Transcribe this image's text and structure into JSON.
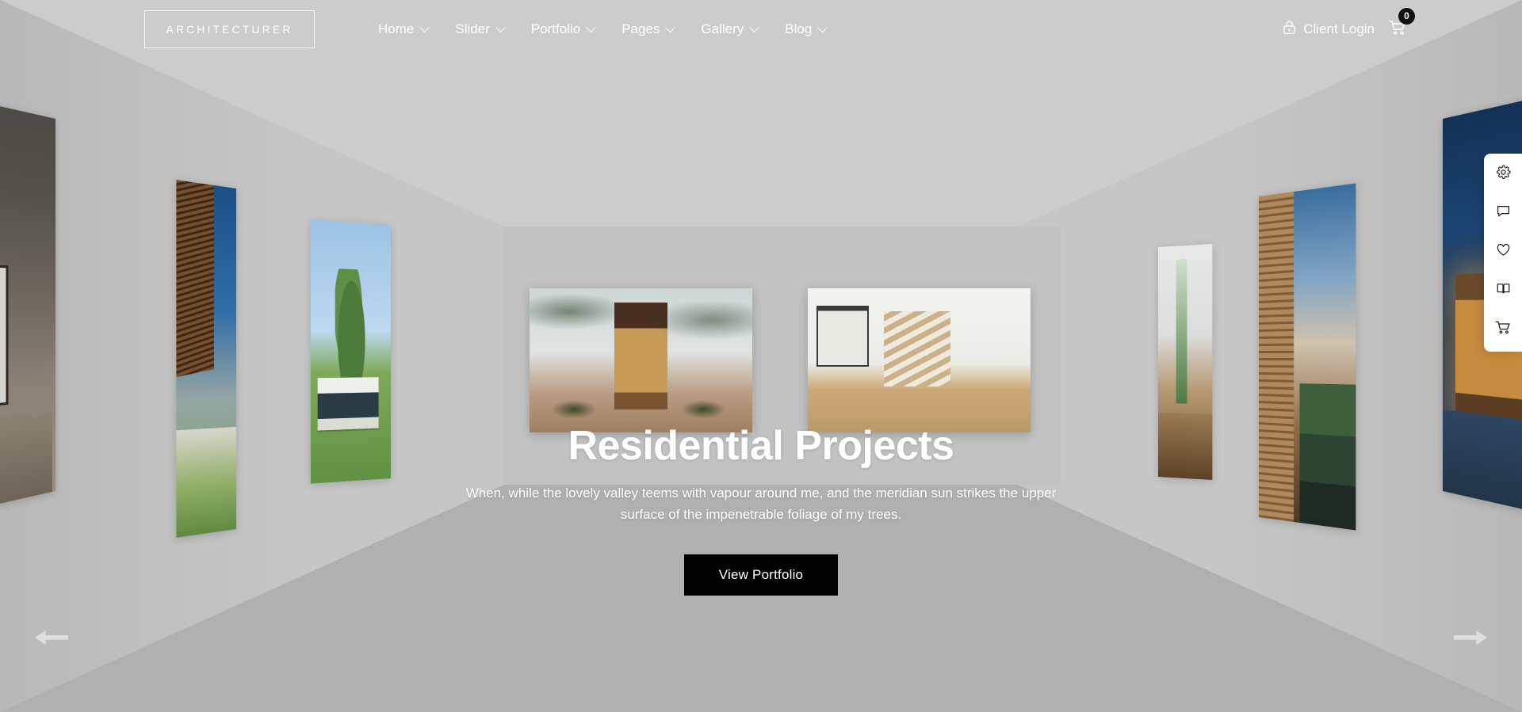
{
  "header": {
    "logo": {
      "text": "ARCHITECTURER",
      "name": "site-logo"
    },
    "nav": [
      {
        "label": "Home",
        "has_dropdown": true
      },
      {
        "label": "Slider",
        "has_dropdown": true
      },
      {
        "label": "Portfolio",
        "has_dropdown": true
      },
      {
        "label": "Pages",
        "has_dropdown": true
      },
      {
        "label": "Gallery",
        "has_dropdown": true
      },
      {
        "label": "Blog",
        "has_dropdown": true
      }
    ],
    "client_login": {
      "label": "Client Login",
      "icon": "lock-icon"
    },
    "cart": {
      "icon": "shopping-cart-icon",
      "count": "0"
    }
  },
  "hero": {
    "title": "Residential Projects",
    "description": "When, while the lovely valley teems with vapour around me, and the meridian sun strikes the upper surface of the impenetrable foliage of my trees.",
    "cta_label": "View Portfolio"
  },
  "side_toolbar": {
    "items": [
      {
        "icon": "gear-icon",
        "label": "Settings"
      },
      {
        "icon": "chat-bubble-icon",
        "label": "Comments"
      },
      {
        "icon": "heart-icon",
        "label": "Favorites"
      },
      {
        "icon": "book-open-icon",
        "label": "Documentation"
      },
      {
        "icon": "shopping-cart-icon",
        "label": "Cart"
      }
    ]
  },
  "slider_nav": {
    "prev": {
      "icon": "arrow-left-icon",
      "label": "Previous slide"
    },
    "next": {
      "icon": "arrow-right-icon",
      "label": "Next slide"
    }
  },
  "gallery": {
    "left_wall": [
      {
        "id": "left-1",
        "alt": "Dark stone-wall interior living room with framed art"
      },
      {
        "id": "left-2",
        "alt": "Timber slat canopy walkway under blue sky"
      },
      {
        "id": "left-3",
        "alt": "White concrete pavilion on green lawn with poplar trees"
      }
    ],
    "right_wall": [
      {
        "id": "right-1",
        "alt": "Bright interior with plants and glass partition"
      },
      {
        "id": "right-2",
        "alt": "Timber and glass courtyard with reflecting pool"
      },
      {
        "id": "right-3",
        "alt": "Night exterior of warm-lit timber clad house"
      }
    ],
    "center": [
      {
        "id": "center-1",
        "alt": "Timber entry doorway with dappled tree shadows on white wall"
      },
      {
        "id": "center-2",
        "alt": "White loft interior with open timber staircase"
      }
    ]
  },
  "colors": {
    "ceiling": "#cccccc",
    "back_wall": "#c2c2c2",
    "side_wall": "#c6c6c6",
    "floor": "#b0b0b0",
    "cta_background": "#000000",
    "cta_text": "#ffffff",
    "badge_background": "#111111",
    "toolbar_background": "#ffffff"
  }
}
